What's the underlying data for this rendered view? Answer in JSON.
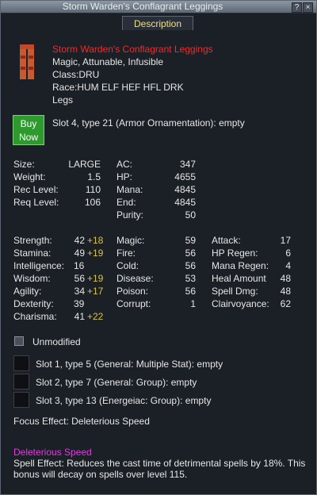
{
  "window": {
    "title": "Storm Warden's Conflagrant Leggings",
    "help_label": "?",
    "close_label": "×",
    "tab": "Description"
  },
  "item": {
    "name": "Storm Warden's Conflagrant Leggings",
    "flags": "Magic, Attunable, Infusible",
    "class": "Class:DRU",
    "race": "Race:HUM ELF HEF HFL DRK",
    "slot": "Legs",
    "icon": "leggings-icon"
  },
  "buy_button": {
    "line1": "Buy",
    "line2": "Now"
  },
  "ornament_slot": "Slot 4, type 21 (Armor Ornamentation): empty",
  "basic": [
    {
      "label": "Size:",
      "value": "LARGE"
    },
    {
      "label": "Weight:",
      "value": "1.5"
    },
    {
      "label": "Rec Level:",
      "value": "110"
    },
    {
      "label": "Req Level:",
      "value": "106"
    }
  ],
  "defense": [
    {
      "label": "AC:",
      "value": "347"
    },
    {
      "label": "HP:",
      "value": "4655"
    },
    {
      "label": "Mana:",
      "value": "4845"
    },
    {
      "label": "End:",
      "value": "4845"
    },
    {
      "label": "Purity:",
      "value": "50"
    }
  ],
  "stats": [
    {
      "label": "Strength:",
      "value": "42",
      "bonus": "+18"
    },
    {
      "label": "Stamina:",
      "value": "49",
      "bonus": "+19"
    },
    {
      "label": "Intelligence:",
      "value": "16",
      "bonus": ""
    },
    {
      "label": "Wisdom:",
      "value": "56",
      "bonus": "+19"
    },
    {
      "label": "Agility:",
      "value": "34",
      "bonus": "+17"
    },
    {
      "label": "Dexterity:",
      "value": "39",
      "bonus": ""
    },
    {
      "label": "Charisma:",
      "value": "41",
      "bonus": "+22"
    }
  ],
  "resists": [
    {
      "label": "Magic:",
      "value": "59"
    },
    {
      "label": "Fire:",
      "value": "56"
    },
    {
      "label": "Cold:",
      "value": "56"
    },
    {
      "label": "Disease:",
      "value": "53"
    },
    {
      "label": "Poison:",
      "value": "56"
    },
    {
      "label": "Corrupt:",
      "value": "1"
    }
  ],
  "mods": [
    {
      "label": "Attack:",
      "value": "17"
    },
    {
      "label": "HP Regen:",
      "value": "6"
    },
    {
      "label": "Mana Regen:",
      "value": "4"
    },
    {
      "label": "Heal Amount",
      "value": "48"
    },
    {
      "label": "Spell Dmg:",
      "value": "48"
    },
    {
      "label": "Clairvoyance:",
      "value": "62"
    }
  ],
  "unmodified": "Unmodified",
  "aug_slots": [
    "Slot 1, type 5 (General: Multiple Stat): empty",
    "Slot 2, type 7 (General: Group): empty",
    "Slot 3, type 13 (Energeiac: Group): empty"
  ],
  "focus": "Focus Effect: Deleterious Speed",
  "effect": {
    "name": "Deleterious Speed",
    "line1": "Spell Effect: Reduces the cast time of detrimental spells by 18%. This",
    "line2": "bonus will decay on spells over level 115."
  }
}
